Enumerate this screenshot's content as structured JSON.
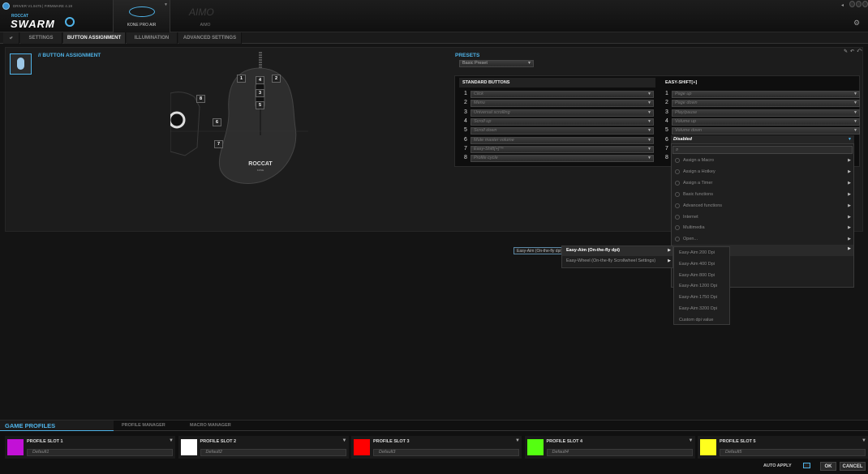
{
  "app": {
    "driver_info": "DRIVER V1.9475 | FIRMWARE 4.19",
    "logo_top": "ROCCAT",
    "logo_main": "SWARM"
  },
  "devices": [
    {
      "label": "KONE PRO AIR",
      "selected": true
    },
    {
      "label": "AIMO",
      "big_label": "AIMO",
      "selected": false
    }
  ],
  "tabs": [
    "SETTINGS",
    "BUTTON ASSIGNMENT",
    "ILLUMINATION",
    "ADVANCED SETTINGS"
  ],
  "section_title": "// BUTTON ASSIGNMENT",
  "mouse_brand": "ROCCAT",
  "mouse_sub": "KONE",
  "mouse_buttons": [
    "1",
    "2",
    "3",
    "4",
    "5",
    "6",
    "7",
    "8"
  ],
  "presets": {
    "label": "PRESETS",
    "value": "Basic Preset"
  },
  "standard": {
    "header": "STANDARD BUTTONS",
    "rows": [
      {
        "n": "1",
        "value": "Click"
      },
      {
        "n": "2",
        "value": "Menu"
      },
      {
        "n": "3",
        "value": "Universal scrolling"
      },
      {
        "n": "4",
        "value": "Scroll up"
      },
      {
        "n": "5",
        "value": "Scroll down"
      },
      {
        "n": "6",
        "value": "Mute master volume"
      },
      {
        "n": "7",
        "value": "Easy-Shift[+]™"
      },
      {
        "n": "8",
        "value": "Profile cycle"
      }
    ]
  },
  "easyshift": {
    "header": "EASY-SHIFT[+]",
    "rows": [
      {
        "n": "1",
        "value": "Page up"
      },
      {
        "n": "2",
        "value": "Page down"
      },
      {
        "n": "3",
        "value": "Play/pause"
      },
      {
        "n": "4",
        "value": "Volume up"
      },
      {
        "n": "5",
        "value": "Volume down"
      },
      {
        "n": "6",
        "value": "Disabled"
      },
      {
        "n": "7",
        "value": ""
      },
      {
        "n": "8",
        "value": ""
      }
    ]
  },
  "main_menu": {
    "search_placeholder": "",
    "items": [
      {
        "label": "Assign a Macro",
        "icon": "macro-icon"
      },
      {
        "label": "Assign a Hotkey",
        "icon": "hotkey-icon"
      },
      {
        "label": "Assign a Timer",
        "icon": "timer-icon"
      },
      {
        "label": "Basic functions",
        "icon": "basic-functions-icon"
      },
      {
        "label": "Advanced functions",
        "icon": "advanced-functions-icon"
      },
      {
        "label": "Internet",
        "icon": "internet-icon"
      },
      {
        "label": "Multimedia",
        "icon": "multimedia-icon"
      },
      {
        "label": "Open...",
        "icon": "open-icon"
      }
    ]
  },
  "tooltip": "Easy-Aim (On-the-fly dpi)",
  "submenu": [
    {
      "label": "Easy-Aim (On-the-fly dpi)",
      "active": true
    },
    {
      "label": "Easy-Wheel (On-the-fly Scrollwheel Settings)",
      "active": false
    }
  ],
  "dpi_menu": [
    "Easy-Aim 200 Dpi",
    "Easy-Aim 400 Dpi",
    "Easy-Aim 800 Dpi",
    "Easy-Aim 1200 Dpi",
    "Easy-Aim 1750 Dpi",
    "Easy-Aim 3200 Dpi",
    "Custom dpi value"
  ],
  "bottom": {
    "tabs": [
      "GAME PROFILES",
      "PROFILE MANAGER",
      "MACRO MANAGER"
    ],
    "slots": [
      {
        "name": "PROFILE SLOT 1",
        "default": "Default1",
        "color": "#c211d6"
      },
      {
        "name": "PROFILE SLOT 2",
        "default": "Default2",
        "color": "#ffffff"
      },
      {
        "name": "PROFILE SLOT 3",
        "default": "Default3",
        "color": "#ff0000"
      },
      {
        "name": "PROFILE SLOT 4",
        "default": "Default4",
        "color": "#55ff11"
      },
      {
        "name": "PROFILE SLOT 5",
        "default": "Default5",
        "color": "#ffff1e"
      }
    ],
    "auto_apply": "AUTO APPLY",
    "ok": "OK",
    "cancel": "CANCEL"
  },
  "colors": {
    "accent": "#4fb3e8"
  }
}
